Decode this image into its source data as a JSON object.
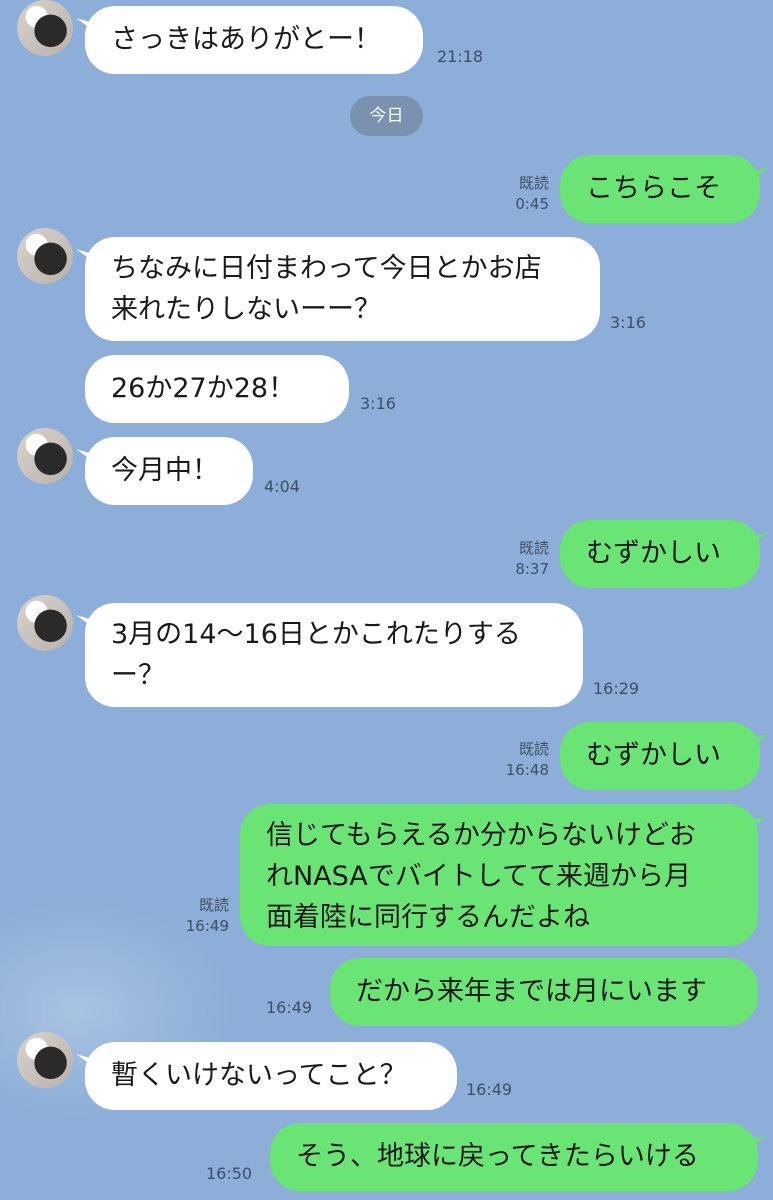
{
  "date_divider": "今日",
  "messages": [
    {
      "text": "さっきはありがとー！",
      "time": "21:18"
    },
    {
      "text": "こちらこそ",
      "read": "既読",
      "time": "0:45"
    },
    {
      "text": "ちなみに日付まわって今日とかお店\n来れたりしないーー？",
      "time": "3:16"
    },
    {
      "text": "26か27か28！",
      "time": "3:16"
    },
    {
      "text": "今月中！",
      "time": "4:04"
    },
    {
      "text": "むずかしい",
      "read": "既読",
      "time": "8:37"
    },
    {
      "text": "3月の14〜16日とかこれたりする\nー？",
      "time": "16:29"
    },
    {
      "text": "むずかしい",
      "read": "既読",
      "time": "16:48"
    },
    {
      "text": "信じてもらえるか分からないけどお\nれNASAでバイトしてて来週から月\n面着陸に同行するんだよね",
      "read": "既読",
      "time": "16:49"
    },
    {
      "text": "だから来年までは月にいます",
      "time": "16:49"
    },
    {
      "text": "暫くいけないってこと？",
      "time": "16:49"
    },
    {
      "text": "そう、地球に戻ってきたらいける",
      "time": "16:50"
    }
  ],
  "colors": {
    "background": "#8caed8",
    "incoming": "#ffffff",
    "outgoing": "#6be476"
  }
}
